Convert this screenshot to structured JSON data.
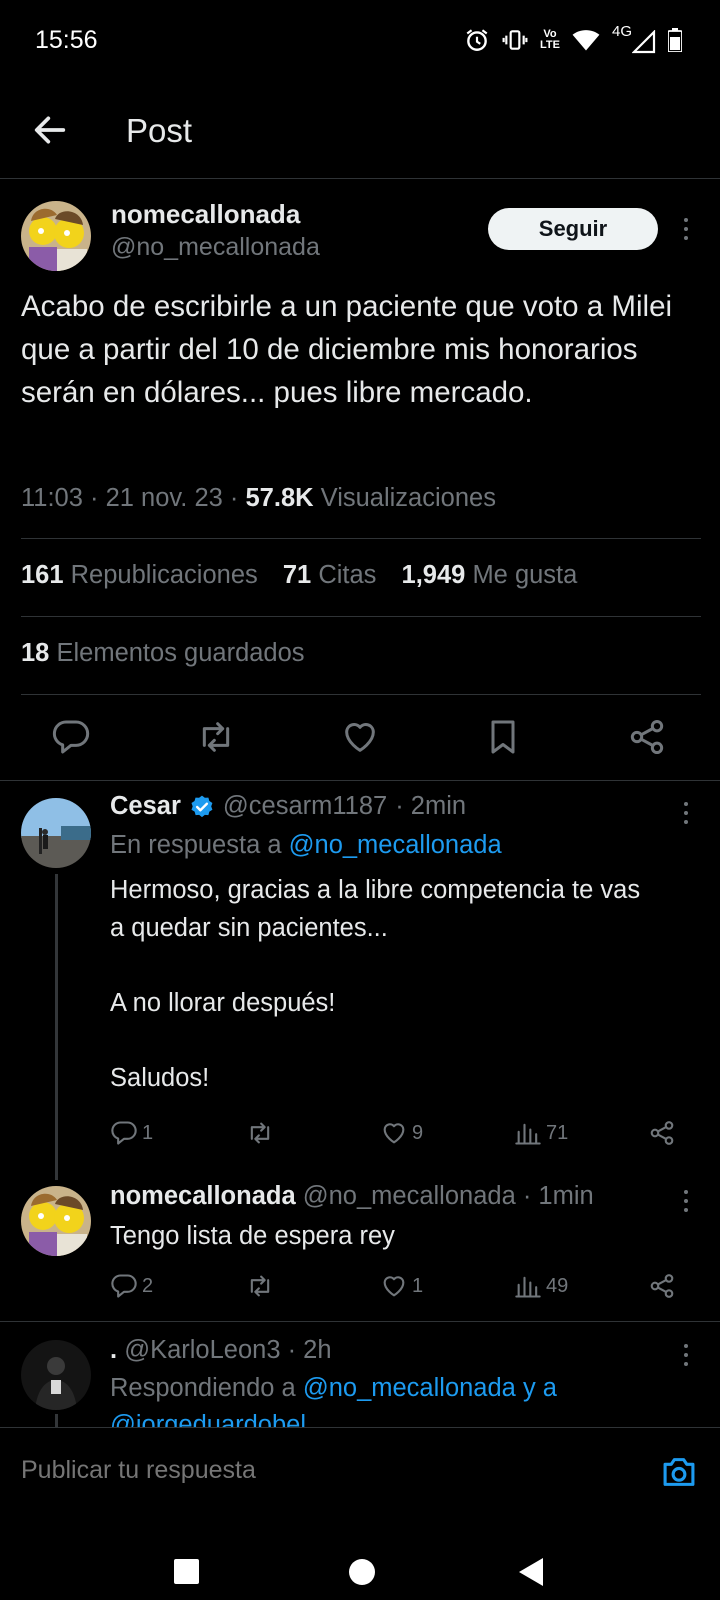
{
  "status_bar": {
    "time": "15:56",
    "network_label": "4G",
    "volte_label_top": "Vo",
    "volte_label_bottom": "LTE",
    "icons": [
      "alarm-icon",
      "vibrate-icon",
      "volte-icon",
      "wifi-icon",
      "signal-icon",
      "battery-icon"
    ]
  },
  "header": {
    "title": "Post",
    "back_icon": "arrow-left-icon"
  },
  "post": {
    "display_name": "nomecallonada",
    "handle": "@no_mecallonada",
    "follow_label": "Seguir",
    "text": "Acabo de escribirle a un paciente que voto a Milei que a partir del 10 de diciembre mis honorarios serán en dólares... pues libre mercado.",
    "time": "11:03",
    "separator": "·",
    "date": "21 nov. 23",
    "views_count": "57.8K",
    "views_label": "Visualizaciones",
    "reposts_count": "161",
    "reposts_label": "Republicaciones",
    "quotes_count": "71",
    "quotes_label": "Citas",
    "likes_count": "1,949",
    "likes_label": "Me gusta",
    "bookmarks_count": "18",
    "bookmarks_label": "Elementos guardados"
  },
  "replies": [
    {
      "display_name": "Cesar",
      "verified": true,
      "handle": "@cesarm1187",
      "time": "· 2min",
      "reply_prefix": "En respuesta a",
      "reply_to": "@no_mecallonada",
      "lines": [
        "Hermoso, gracias a la libre competencia te vas",
        "a quedar sin pacientes...",
        "",
        "A no llorar después!",
        "",
        "Saludos!"
      ],
      "replies_count": "1",
      "reposts_count": "",
      "likes_count": "9",
      "views_count": "71"
    },
    {
      "display_name": "nomecallonada",
      "handle": "@no_mecallonada",
      "time": "· 1min",
      "text": "Tengo lista de espera rey",
      "replies_count": "2",
      "reposts_count": "",
      "likes_count": "1",
      "views_count": "49"
    },
    {
      "display_name": ".",
      "handle": "@KarloLeon3",
      "time": "· 2h",
      "reply_prefix": "Respondiendo a",
      "reply_to": "@no_mecallonada y a",
      "reply_to_2": "@jorgeduardobel"
    }
  ],
  "composer": {
    "placeholder": "Publicar tu respuesta"
  },
  "colors": {
    "background": "#000000",
    "text": "#e7e9ea",
    "muted": "#71767b",
    "accent": "#1d9bf0",
    "divider": "#2f3336"
  }
}
